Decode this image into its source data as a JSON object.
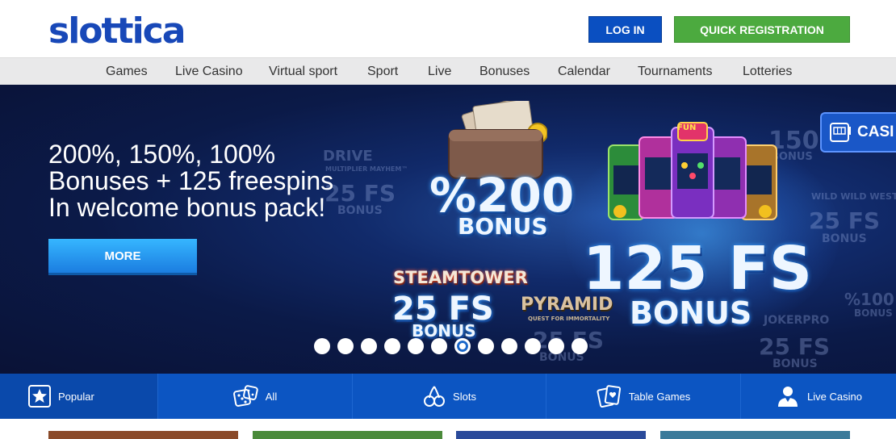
{
  "header": {
    "logo": "slottica",
    "login_label": "LOG IN",
    "register_label": "QUICK REGISTRATION"
  },
  "nav": [
    "Games",
    "Live Casino",
    "Virtual sport",
    "Sport",
    "Live",
    "Bonuses",
    "Calendar",
    "Tournaments",
    "Lotteries"
  ],
  "hero": {
    "title_lines": [
      "200%, 150%, 100%",
      "Bonuses + 125 freespins",
      "In welcome bonus pack!"
    ],
    "more_label": "MORE",
    "promo_200_value": "%200",
    "promo_200_label": "BONUS",
    "promo_125_value": "125 FS",
    "promo_125_label": "BONUS",
    "steamtower_title": "STEAMTOWER",
    "steamtower_value": "25 FS",
    "steamtower_label": "BONUS",
    "pyramid_title": "PYRAMID",
    "pyramid_sub": "QUEST FOR IMMORTALITY",
    "ghost_drive_title": "DRIVE",
    "ghost_drive_sub": "MULTIPLIER MAYHEM™",
    "ghost_drive_value": "25 FS",
    "ghost_drive_label": "BONUS",
    "ghost_wild_title": "WILD WILD WEST",
    "ghost_wild_value": "25 FS",
    "ghost_wild_label": "BONUS",
    "ghost_150_value": "150",
    "ghost_150_label": "BONUS",
    "ghost_100_value": "%100",
    "ghost_100_label": "BONUS",
    "ghost_joker_title": "JOKERPRO",
    "ghost_joker_value": "25 FS",
    "ghost_joker_label": "BONUS",
    "ghost_pyramid_value": "25 FS",
    "ghost_pyramid_label": "BONUS",
    "machine_sign": "FUN",
    "casino_tab_label": "CASI",
    "slide_count": 12,
    "active_slide": 7
  },
  "categories": [
    {
      "label": "Popular",
      "icon": "star-icon",
      "active": true
    },
    {
      "label": "All",
      "icon": "dice-icon",
      "active": false
    },
    {
      "label": "Slots",
      "icon": "cherries-icon",
      "active": false
    },
    {
      "label": "Table Games",
      "icon": "cards-icon",
      "active": false
    },
    {
      "label": "Live Casino",
      "icon": "dealer-icon",
      "active": false
    }
  ],
  "colors": {
    "brand_blue": "#1848b8",
    "login_blue": "#0a4fc1",
    "register_green": "#4caa3f",
    "category_bar": "#0c55c2"
  }
}
